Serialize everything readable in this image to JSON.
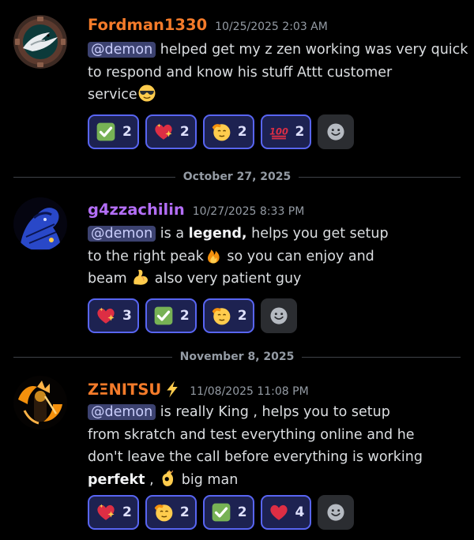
{
  "messages": [
    {
      "username": "Fordman1330",
      "username_color": "#f47b2a",
      "timestamp": "10/25/2025 2:03 AM",
      "mention": "@demon",
      "line1_rest": " helped get my z zen working was very quick",
      "line2": "to respond and know his stuff Attt customer",
      "line3": "service",
      "reactions": [
        {
          "emoji": "check-mark-emoji",
          "count": "2"
        },
        {
          "emoji": "sparkling-heart-emoji",
          "count": "2"
        },
        {
          "emoji": "saluting-face-emoji",
          "count": "2"
        },
        {
          "emoji": "hundred-points-emoji",
          "count": "2"
        }
      ]
    },
    {
      "username": "g4zzachilin",
      "username_color": "#b36ef6",
      "timestamp": "10/27/2025 8:33 PM",
      "mention": "@demon",
      "line1_pre": " is a ",
      "line1_bold": "legend,",
      "line1_post": " helps you get setup",
      "line2a": "to the right peak",
      "line2b": " so you can enjoy and",
      "line3a": "beam ",
      "line3b": " also very patient guy",
      "reactions": [
        {
          "emoji": "sparkling-heart-emoji",
          "count": "3"
        },
        {
          "emoji": "check-mark-emoji",
          "count": "2"
        },
        {
          "emoji": "saluting-face-emoji",
          "count": "2"
        }
      ]
    },
    {
      "username": "ZΞNITSU",
      "username_color": "#f47b2a",
      "timestamp": "11/08/2025 11:08 PM",
      "mention": "@demon",
      "line1_rest": " is really King , helps you to setup",
      "line2": "from skratch and test everything online and he",
      "line3": "don't leave the call before everything is working",
      "line4_bold": "perfekt",
      "line4_mid": " , ",
      "line4_end": " big man",
      "reactions": [
        {
          "emoji": "sparkling-heart-emoji",
          "count": "2"
        },
        {
          "emoji": "saluting-face-emoji",
          "count": "2"
        },
        {
          "emoji": "check-mark-emoji",
          "count": "2"
        },
        {
          "emoji": "red-heart-emoji",
          "count": "4"
        }
      ]
    }
  ],
  "dividers": [
    "October 27, 2025",
    "November 8, 2025"
  ],
  "colors": {
    "mention_bg": "#3c4270",
    "reaction_border": "#5865f2",
    "reaction_bg": "#1d2251"
  }
}
